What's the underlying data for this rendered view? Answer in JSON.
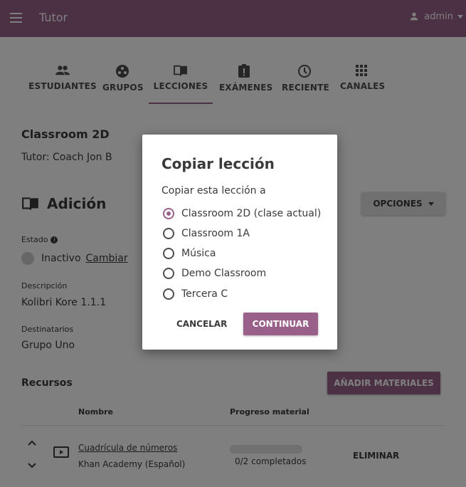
{
  "colors": {
    "brand": "#996189",
    "text": "#3a3a3a",
    "overlay": "rgba(0,0,0,0.5)"
  },
  "appbar": {
    "title": "Tutor",
    "user": "admin",
    "menu_icon": "hamburger-icon",
    "user_icon": "person-icon"
  },
  "tabs": [
    {
      "label": "ESTUDIANTES",
      "icon": "people-icon"
    },
    {
      "label": "GRUPOS",
      "icon": "groups-icon"
    },
    {
      "label": "LECCIONES",
      "icon": "book-icon",
      "active": true
    },
    {
      "label": "EXÁMENES",
      "icon": "exam-icon"
    },
    {
      "label": "RECIENTE",
      "icon": "clock-icon"
    },
    {
      "label": "CANALES",
      "icon": "apps-icon"
    }
  ],
  "classroom": {
    "name": "Classroom 2D",
    "tutor": "Tutor: Coach Jon B"
  },
  "lesson": {
    "title": "Adición",
    "options_label": "OPCIONES",
    "status_label": "Estado",
    "status_value": "Inactivo",
    "status_change": "Cambiar",
    "description_label": "Descripción",
    "description_value": "Kolibri Kore 1.1.1",
    "recipients_label": "Destinatarios",
    "recipients_value": "Grupo Uno"
  },
  "resources": {
    "title": "Recursos",
    "add_label": "AÑADIR MATERIALES",
    "col_name": "Nombre",
    "col_progress": "Progreso material",
    "rows": [
      {
        "name": "Cuadrícula de números",
        "channel": "Khan Academy (Español)",
        "progress_text": "0/2 completados",
        "progress_fraction": 0,
        "remove_label": "ELIMINAR"
      }
    ]
  },
  "dialog": {
    "title": "Copiar lección",
    "subtitle": "Copiar esta lección a",
    "options": [
      {
        "label": "Classroom 2D (clase actual)",
        "selected": true
      },
      {
        "label": "Classroom 1A",
        "selected": false
      },
      {
        "label": "Música",
        "selected": false
      },
      {
        "label": "Demo Classroom",
        "selected": false
      },
      {
        "label": "Tercera C",
        "selected": false
      }
    ],
    "cancel_label": "CANCELAR",
    "continue_label": "CONTINUAR"
  }
}
